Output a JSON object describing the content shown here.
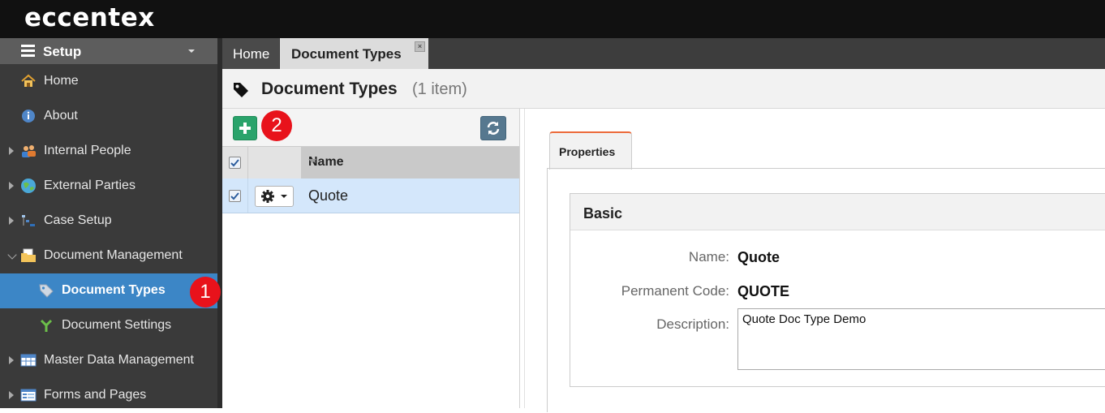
{
  "app": {
    "logo": "eccentex"
  },
  "sidebar": {
    "header": "Setup",
    "items": [
      {
        "label": "Home"
      },
      {
        "label": "About"
      },
      {
        "label": "Internal People"
      },
      {
        "label": "External Parties"
      },
      {
        "label": "Case Setup"
      },
      {
        "label": "Document Management"
      },
      {
        "label": "Document Types"
      },
      {
        "label": "Document Settings"
      },
      {
        "label": "Master Data Management"
      },
      {
        "label": "Forms and Pages"
      }
    ]
  },
  "badges": {
    "one": "1",
    "two": "2"
  },
  "tabs": [
    {
      "label": "Home"
    },
    {
      "label": "Document Types"
    }
  ],
  "page": {
    "title": "Document Types",
    "count": "(1 item)"
  },
  "grid": {
    "column": "Name",
    "rows": [
      {
        "name": "Quote"
      }
    ]
  },
  "details": {
    "tab": "Properties",
    "section": "Basic",
    "fields": {
      "name_label": "Name:",
      "name_value": "Quote",
      "code_label": "Permanent Code:",
      "code_value": "QUOTE",
      "desc_label": "Description:",
      "desc_value": "Quote Doc Type Demo"
    }
  },
  "colors": {
    "accent": "#3c86c6",
    "add": "#2aa36b",
    "badge": "#e8121b",
    "tab_accent": "#ec6a3a"
  }
}
